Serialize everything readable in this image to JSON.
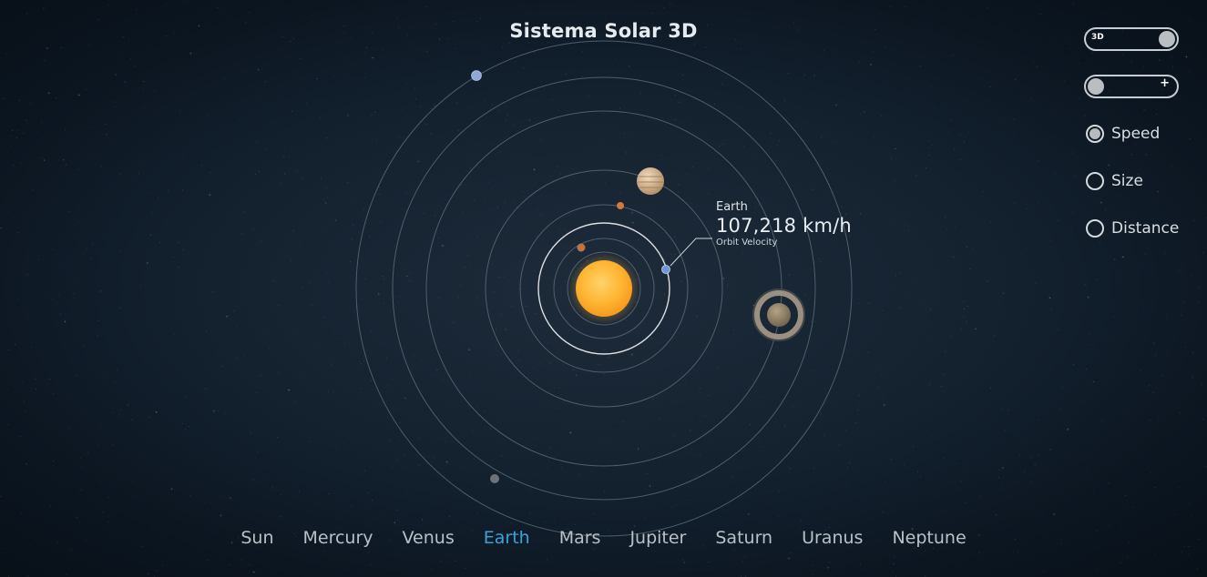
{
  "title": "Sistema Solar 3D",
  "selected_planet": {
    "name": "Earth",
    "value": "107,218 km/h",
    "label": "Orbit Velocity"
  },
  "controls": {
    "view_toggle": {
      "label": "3D",
      "on": true
    },
    "zoom_toggle": {
      "label": "+",
      "on": false
    },
    "radios": [
      {
        "label": "Speed",
        "checked": true
      },
      {
        "label": "Size",
        "checked": false
      },
      {
        "label": "Distance",
        "checked": false
      }
    ]
  },
  "nav": {
    "items": [
      "Sun",
      "Mercury",
      "Venus",
      "Earth",
      "Mars",
      "Jupiter",
      "Saturn",
      "Uranus",
      "Neptune"
    ],
    "active": "Earth"
  },
  "colors": {
    "background": "#142230",
    "active_nav": "#3ba3d9",
    "sun": "#ffb93b",
    "orbit": "#5b6a77"
  }
}
